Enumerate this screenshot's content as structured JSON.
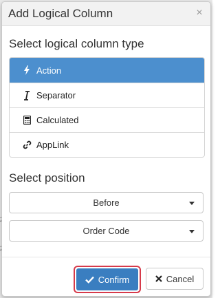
{
  "dialog": {
    "title": "Add Logical Column",
    "close_label": "×"
  },
  "type_section": {
    "title": "Select logical column type",
    "items": [
      {
        "label": "Action",
        "icon": "bolt-icon",
        "active": true
      },
      {
        "label": "Separator",
        "icon": "italic-i-icon",
        "active": false
      },
      {
        "label": "Calculated",
        "icon": "calculator-icon",
        "active": false
      },
      {
        "label": "AppLink",
        "icon": "link-icon",
        "active": false
      }
    ]
  },
  "position_section": {
    "title": "Select position",
    "placement": {
      "selected": "Before"
    },
    "column": {
      "selected": "Order Code"
    }
  },
  "footer": {
    "confirm_label": "Confirm",
    "cancel_label": "Cancel"
  },
  "colors": {
    "active_item": "#4c8fce",
    "confirm_button": "#3a7ec0",
    "highlight_outline": "#d63a4a"
  }
}
